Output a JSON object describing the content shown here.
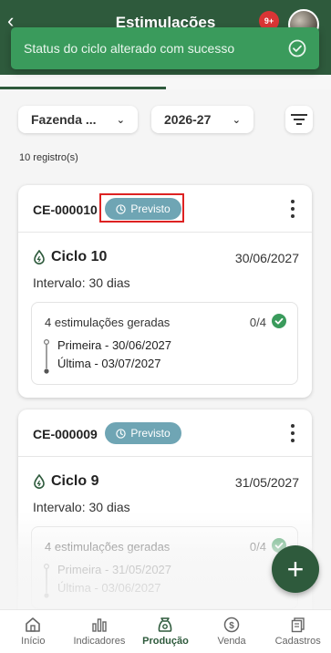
{
  "header": {
    "title": "Estimulações",
    "notification_count": "9+"
  },
  "toast": {
    "message": "Status do ciclo alterado com sucesso"
  },
  "filters": {
    "farm": "Fazenda ...",
    "year": "2026-27"
  },
  "records_count": "10 registro(s)",
  "cards": [
    {
      "code": "CE-000010",
      "status": "Previsto",
      "cycle": "Ciclo 10",
      "date": "30/06/2027",
      "interval": "Intervalo: 30 dias",
      "stimulations": "4 estimulações geradas",
      "progress": "0/4",
      "first": "Primeira - 30/06/2027",
      "last": "Última - 03/07/2027"
    },
    {
      "code": "CE-000009",
      "status": "Previsto",
      "cycle": "Ciclo 9",
      "date": "31/05/2027",
      "interval": "Intervalo: 30 dias",
      "stimulations": "4 estimulações geradas",
      "progress": "0/4",
      "first": "Primeira - 31/05/2027",
      "last": "Última - 03/06/2027"
    }
  ],
  "fab_label": "+",
  "bottom_nav": [
    {
      "label": "Início",
      "icon": "home-icon"
    },
    {
      "label": "Indicadores",
      "icon": "bar-chart-icon"
    },
    {
      "label": "Produção",
      "icon": "production-icon",
      "active": true
    },
    {
      "label": "Venda",
      "icon": "dollar-icon"
    },
    {
      "label": "Cadastros",
      "icon": "document-icon"
    }
  ],
  "colors": {
    "primary": "#2e5a3c",
    "toast": "#3a9b5c",
    "badge": "#6fa5b4",
    "success": "#3a9b5c"
  }
}
